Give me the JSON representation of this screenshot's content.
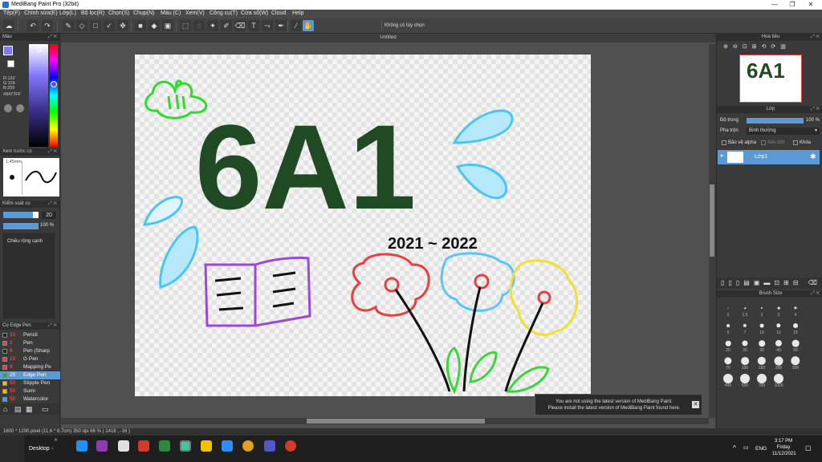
{
  "app": {
    "title": "MediBang Paint Pro (32bit)",
    "window_controls": [
      "—",
      "❐",
      "✕"
    ]
  },
  "menu": [
    "Tệp(F)",
    "Chỉnh sửa(E)",
    "Lớp(L)",
    "Bộ lọc(R)",
    "Chọn(S)",
    "Chụp(N)",
    "Màu (C)",
    "Xem(V)",
    "Công cụ(T)",
    "Cửa sổ(W)",
    "Cloud",
    "Help"
  ],
  "toolbar": {
    "options_note": "Không có tùy chọn"
  },
  "document": {
    "tab_title": "Untitled",
    "art_title": "6A1",
    "art_years": "2021 ~ 2022"
  },
  "color_panel": {
    "title": "Màu",
    "r": "R:132",
    "g": "G:119",
    "b": "B:255",
    "hex": "#8477FF",
    "primary_color": "#8477FF"
  },
  "brush_preview": {
    "title": "Xem trước cọ",
    "size": "1.45mm"
  },
  "brush_control": {
    "title": "Kiểm soát cọ",
    "size_value": "20",
    "opacity_value": "100 %",
    "size_fill": 0.85,
    "opacity_fill": 1.0,
    "antialias_label": "Chiều rộng cạnh"
  },
  "brush_list": {
    "title": "Cọ Edge Pen",
    "items": [
      {
        "size": "10",
        "name": "Pencil",
        "color": "#222222"
      },
      {
        "size": "2",
        "name": "Pen",
        "color": "#e84040"
      },
      {
        "size": "8",
        "name": "Pen (Sharp",
        "color": "#222222"
      },
      {
        "size": "10",
        "name": "G Pen",
        "color": "#e84040"
      },
      {
        "size": "8",
        "name": "Mapping Pe",
        "color": "#e84040"
      },
      {
        "size": "20",
        "name": "Edge Pen",
        "color": "#1fae3a"
      },
      {
        "size": "50",
        "name": "Stipple Pen",
        "color": "#f2c200"
      },
      {
        "size": "50",
        "name": "Sumi",
        "color": "#f2c200"
      },
      {
        "size": "50",
        "name": "Watercolor",
        "color": "#3aa0ff"
      }
    ]
  },
  "navigator": {
    "title": "Hoa tiêu"
  },
  "layer_panel": {
    "title": "Lớp",
    "opacity_label": "Độ trong",
    "opacity_value": "100 %",
    "opacity_fill": 1.0,
    "blend_label": "Pha trộn",
    "blend_value": "Bình thường",
    "protect_alpha": "Bảo vệ alpha",
    "clipping": "Xén bớt",
    "lock": "Khóa",
    "layers": [
      {
        "name": "Lớp1"
      }
    ]
  },
  "brush_size_panel": {
    "title": "Brush Size",
    "sizes": [
      "1",
      "1.5",
      "2",
      "3",
      "4",
      "5",
      "7",
      "10",
      "12",
      "15",
      "20",
      "25",
      "30",
      "40",
      "50",
      "70",
      "100",
      "150",
      "200",
      "300",
      "400",
      "500",
      "700",
      "1000"
    ]
  },
  "notification": {
    "line1": "You are not using the latest version of MediBang Paint.",
    "line2": "Please install the latest version of MediBang Paint found here."
  },
  "status": {
    "text": "1600 * 1200 pixel   (11.6 * 8.7cm)   350 dpi   66 %   ( 1418 , -16 )"
  },
  "taskbar": {
    "desktop_label": "Desktop",
    "lang": "ENG",
    "time": "3:17 PM",
    "day": "Friday",
    "date": "11/12/2021"
  }
}
